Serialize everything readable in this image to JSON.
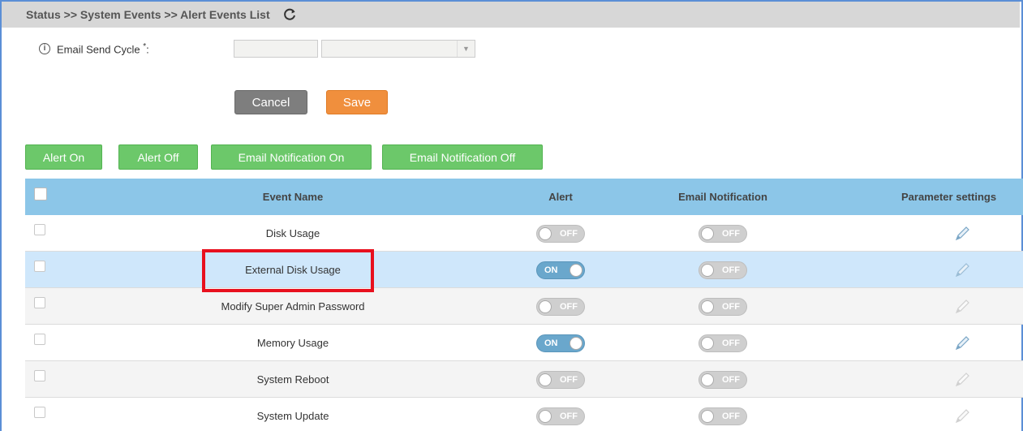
{
  "header": {
    "breadcrumb": "Status >> System Events >> Alert Events List",
    "refresh_icon": "refresh-icon"
  },
  "email_cycle": {
    "label": "Email Send Cycle",
    "required_mark": "*",
    "suffix": ":",
    "info_icon": "info-icon",
    "input_value": "",
    "select_value": ""
  },
  "form_actions": {
    "cancel_label": "Cancel",
    "save_label": "Save"
  },
  "bulk_actions": {
    "alert_on": "Alert On",
    "alert_off": "Alert Off",
    "email_on": "Email Notification On",
    "email_off": "Email Notification Off"
  },
  "table": {
    "headers": {
      "event_name": "Event Name",
      "alert": "Alert",
      "email": "Email Notification",
      "params": "Parameter settings"
    },
    "rows": [
      {
        "name": "Disk Usage",
        "alert": "OFF",
        "email": "OFF"
      },
      {
        "name": "External Disk Usage",
        "alert": "ON",
        "email": "OFF"
      },
      {
        "name": "Modify Super Admin Password",
        "alert": "OFF",
        "email": "OFF"
      },
      {
        "name": "Memory Usage",
        "alert": "ON",
        "email": "OFF"
      },
      {
        "name": "System Reboot",
        "alert": "OFF",
        "email": "OFF"
      },
      {
        "name": "System Update",
        "alert": "OFF",
        "email": "OFF"
      }
    ]
  },
  "colors": {
    "header_bar": "#d7d7d7",
    "table_header": "#8cc6e8",
    "selected_row": "#cfe7fb",
    "green_button": "#6cc86a",
    "save_button": "#f08f3d",
    "cancel_button": "#7e7e7e",
    "highlight": "#e8101e"
  }
}
